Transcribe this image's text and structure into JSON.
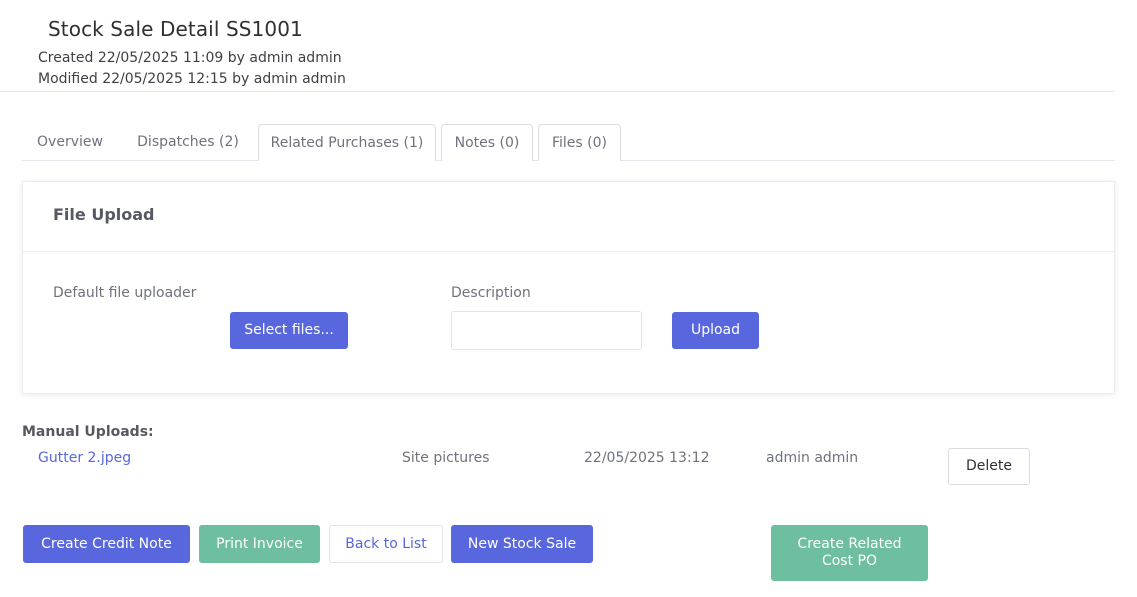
{
  "header": {
    "title": "Stock Sale Detail SS1001",
    "created": "Created 22/05/2025 11:09 by admin admin",
    "modified": "Modified 22/05/2025 12:15 by admin admin"
  },
  "tabs": [
    {
      "label": "Overview"
    },
    {
      "label": "Dispatches (2)"
    },
    {
      "label": "Related Purchases (1)"
    },
    {
      "label": "Notes (0)"
    },
    {
      "label": "Files (0)"
    }
  ],
  "upload_panel": {
    "title": "File Upload",
    "uploader_label": "Default file uploader",
    "select_files_label": "Select files...",
    "description_label": "Description",
    "description_value": "",
    "upload_label": "Upload"
  },
  "manual_uploads": {
    "label": "Manual Uploads:",
    "rows": [
      {
        "file": "Gutter 2.jpeg",
        "description": "Site pictures",
        "date": "22/05/2025 13:12",
        "user": "admin admin",
        "action": "Delete"
      }
    ]
  },
  "actions": {
    "create_credit_note": "Create Credit Note",
    "print_invoice": "Print Invoice",
    "back_to_list": "Back to List",
    "new_stock_sale": "New Stock Sale",
    "create_related_cost_po_line1": "Create Related",
    "create_related_cost_po_line2": "Cost PO"
  },
  "colors": {
    "primary": "#5867dd",
    "success": "#6ebea0",
    "text": "#3f4047",
    "muted": "#6f727d"
  }
}
